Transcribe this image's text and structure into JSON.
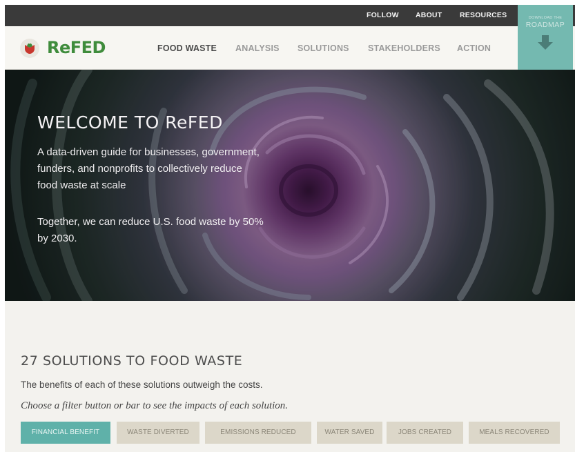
{
  "topbar": {
    "links": [
      "FOLLOW",
      "ABOUT",
      "RESOURCES"
    ]
  },
  "roadmap": {
    "small": "DOWNLOAD THE",
    "big": "ROADMAP",
    "icon": "download-arrow-icon"
  },
  "brand": {
    "name": "ReFED",
    "logo_icon": "refed-logo-icon",
    "color": "#3f8c3c"
  },
  "nav": {
    "items": [
      "FOOD WASTE",
      "ANALYSIS",
      "SOLUTIONS",
      "STAKEHOLDERS",
      "ACTION"
    ],
    "active": "FOOD WASTE"
  },
  "hero": {
    "title": "WELCOME TO ReFED",
    "paragraph1": "A data-driven guide for businesses, government, funders, and nonprofits to collectively reduce food waste at scale",
    "paragraph2": "Together, we can reduce U.S. food waste by 50% by 2030."
  },
  "solutions": {
    "title": "27 SOLUTIONS TO FOOD WASTE",
    "description": "The benefits of each of these solutions outweigh the costs.",
    "instruction": "Choose a filter button or bar to see the impacts of each solution.",
    "filters": [
      "FINANCIAL BENEFIT",
      "WASTE DIVERTED",
      "EMISSIONS REDUCED",
      "WATER SAVED",
      "JOBS CREATED",
      "MEALS RECOVERED"
    ],
    "active_filter": "FINANCIAL BENEFIT"
  },
  "colors": {
    "accent": "#5fb1a9",
    "topbar": "#3a3a3a",
    "filter_inactive": "#dcd7c9"
  }
}
